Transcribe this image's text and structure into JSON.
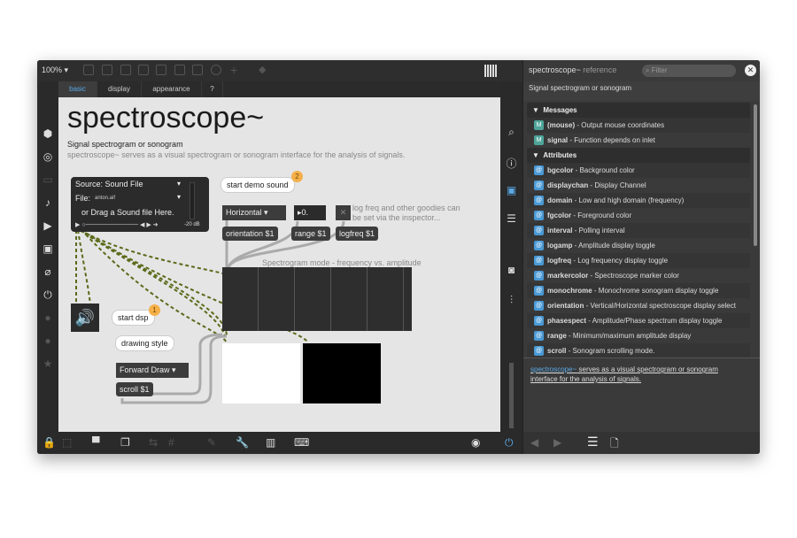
{
  "toolbar": {
    "zoom": "100% ▾"
  },
  "tabs": [
    "basic",
    "display",
    "appearance",
    "?"
  ],
  "help": {
    "title": "spectroscope~",
    "subtitle": "Signal spectrogram or sonogram",
    "description": "spectroscope~ serves as a visual spectrogram or sonogram interface for the analysis of signals.",
    "player": {
      "source": "Source: Sound File",
      "file_label": "File:",
      "file": "anton.aif",
      "drag": "or Drag a Sound file Here.",
      "db": "-20 dB"
    },
    "start_demo": "start demo sound",
    "badge2": "2",
    "start_dsp": "start dsp",
    "badge1": "1",
    "orientation_menu": "Horizontal",
    "range_number": "0.",
    "logfreq_comment": "log freq and other goodies can be set via the inspector...",
    "orientation_msg": "orientation $1",
    "range_msg": "range $1",
    "logfreq_msg": "logfreq $1",
    "spectrogram_comment": "Spectrogram mode - frequency vs. amplitude",
    "drawing_style": "drawing style",
    "draw_menu": "Forward Draw",
    "scroll_msg": "scroll $1"
  },
  "reference": {
    "title": "spectroscope~",
    "title_suffix": " reference",
    "filter_placeholder": "Filter",
    "summary": "Signal spectrogram or sonogram",
    "messages_header": "Messages",
    "messages": [
      {
        "name": "(mouse)",
        "desc": " - Output mouse coordinates"
      },
      {
        "name": "signal",
        "desc": " - Function depends on inlet"
      }
    ],
    "attributes_header": "Attributes",
    "attributes": [
      {
        "name": "bgcolor",
        "desc": " - Background color"
      },
      {
        "name": "displaychan",
        "desc": " - Display Channel"
      },
      {
        "name": "domain",
        "desc": " - Low and high domain (frequency)"
      },
      {
        "name": "fgcolor",
        "desc": " - Foreground color"
      },
      {
        "name": "interval",
        "desc": " - Polling interval"
      },
      {
        "name": "logamp",
        "desc": " - Amplitude display toggle"
      },
      {
        "name": "logfreq",
        "desc": " - Log frequency display toggle"
      },
      {
        "name": "markercolor",
        "desc": " - Spectroscope marker color"
      },
      {
        "name": "monochrome",
        "desc": " - Monochrome sonogram display toggle"
      },
      {
        "name": "orientation",
        "desc": " - Vertical/Horizontal spectroscope display select"
      },
      {
        "name": "phasespect",
        "desc": " - Amplitude/Phase spectrum display toggle"
      },
      {
        "name": "range",
        "desc": " - Minimum/maximum amplitude display"
      },
      {
        "name": "scroll",
        "desc": " - Sonogram scrolling mode."
      }
    ],
    "footer_link": "spectroscope~",
    "footer_text": " serves as a visual spectrogram or sonogram interface for the analysis of signals."
  },
  "colors": {
    "accent": "#5aa9e6",
    "badge": "#f5b04a"
  }
}
